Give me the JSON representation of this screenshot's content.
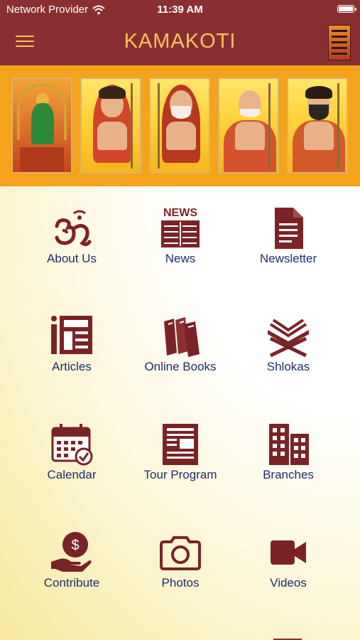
{
  "status_bar": {
    "carrier": "Network Provider",
    "time": "11:39 AM"
  },
  "header": {
    "title": "KAMAKOTI",
    "colors": {
      "bar": "#8a2f31",
      "title": "#f6c55d"
    }
  },
  "banner": {
    "portrait_count": 5,
    "background": "#f5a21c"
  },
  "menu": {
    "items": [
      {
        "label": "About Us",
        "icon": "om-icon"
      },
      {
        "label": "News",
        "icon": "newspaper-icon"
      },
      {
        "label": "Newsletter",
        "icon": "document-icon"
      },
      {
        "label": "Articles",
        "icon": "articles-icon"
      },
      {
        "label": "Online Books",
        "icon": "books-icon"
      },
      {
        "label": "Shlokas",
        "icon": "open-book-icon"
      },
      {
        "label": "Calendar",
        "icon": "calendar-icon"
      },
      {
        "label": "Tour Program",
        "icon": "tour-program-icon"
      },
      {
        "label": "Branches",
        "icon": "buildings-icon"
      },
      {
        "label": "Contribute",
        "icon": "donation-hand-icon"
      },
      {
        "label": "Photos",
        "icon": "camera-icon"
      },
      {
        "label": "Videos",
        "icon": "video-camera-icon"
      }
    ],
    "news_icon_text": "NEWS",
    "colors": {
      "icon": "#7a2326",
      "label": "#1f2c6b"
    }
  }
}
